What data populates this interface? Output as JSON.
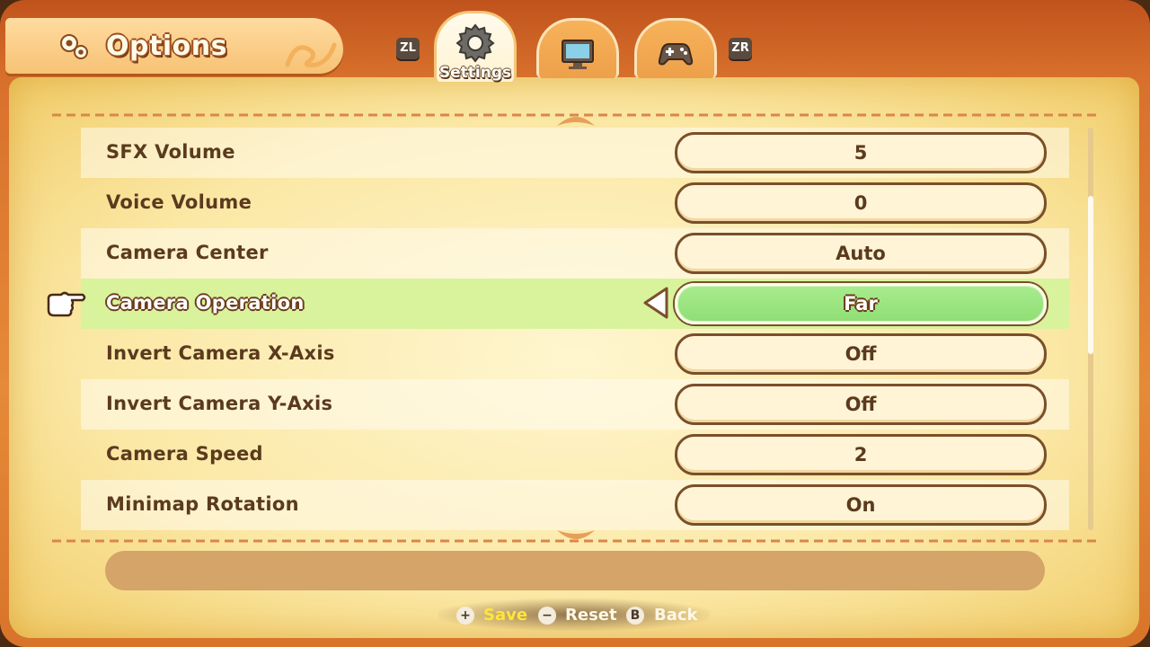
{
  "header": {
    "title": "Options",
    "zl_label": "ZL",
    "zr_label": "ZR"
  },
  "tabs": [
    {
      "label": "Settings",
      "icon": "gear-icon",
      "active": true
    },
    {
      "label": "",
      "icon": "monitor-icon",
      "active": false
    },
    {
      "label": "",
      "icon": "gamepad-icon",
      "active": false
    }
  ],
  "settings": [
    {
      "label": "SFX Volume",
      "value": "5"
    },
    {
      "label": "Voice Volume",
      "value": "0"
    },
    {
      "label": "Camera Center",
      "value": "Auto"
    },
    {
      "label": "Camera Operation",
      "value": "Far",
      "selected": true
    },
    {
      "label": "Invert Camera X-Axis",
      "value": "Off"
    },
    {
      "label": "Invert Camera Y-Axis",
      "value": "Off"
    },
    {
      "label": "Camera Speed",
      "value": "2"
    },
    {
      "label": "Minimap Rotation",
      "value": "On"
    }
  ],
  "footer": {
    "save_icon": "+",
    "save_label": "Save",
    "reset_icon": "−",
    "reset_label": "Reset",
    "back_icon": "B",
    "back_label": "Back"
  },
  "colors": {
    "selected_row": "#d9f29c",
    "selected_value": "#8fde74",
    "save_text": "#ffe53a",
    "text_brown": "#5b3a1e"
  }
}
